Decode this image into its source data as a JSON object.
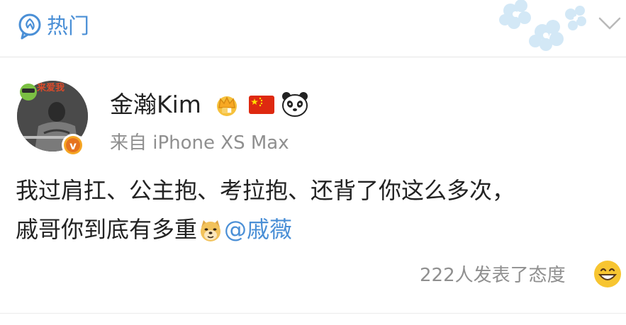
{
  "header": {
    "tab_label": "热门",
    "tab_icon": "hot-topic-icon",
    "collapse_icon": "chevron-down-icon",
    "accent_color": "#4a8fd6"
  },
  "post": {
    "author": {
      "name": "金瀚Kim",
      "avatar_badge_text": "来爱我",
      "verified_badge": "v",
      "badges": [
        "crown-icon",
        "china-flag-icon",
        "panda-icon"
      ]
    },
    "source": "来自 iPhone XS Max",
    "text_line1": "我过肩扛、公主抱、考拉抱、还背了你这么多次，",
    "text_line2_part": "戚哥你到底有多重",
    "emoji_inline": "doge-emoji",
    "mention": "@戚薇",
    "reactions_text": "222人发表了态度",
    "reaction_emoji": "smile-emoji"
  }
}
